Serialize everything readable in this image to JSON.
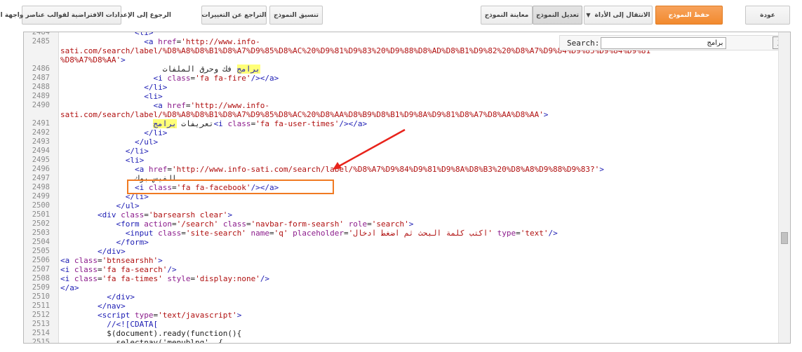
{
  "toolbar": {
    "back": "عودة",
    "save_template": "حفظ النموذج",
    "jump_to_widget": "الانتقال إلى الأداة",
    "edit_template": "تعديل النموذج",
    "preview_template": "معاينة النموذج",
    "format_template": "تنسيق النموذج",
    "revert_changes": "التراجع عن التغييرات",
    "revert_widget_defaults": "الرجوع إلى الإعدادات الافتراضية لقوالب عناصر واجهة المستخدم"
  },
  "search": {
    "label": "Search:",
    "value": "برامج",
    "close": "X"
  },
  "editor": {
    "lines": [
      {
        "n": "2484",
        "segs": [
          [
            "t",
            "                <li>"
          ]
        ]
      },
      {
        "n": "2485",
        "segs": [
          [
            "t",
            "                  <a "
          ],
          [
            "a",
            "href"
          ],
          [
            "x",
            "="
          ],
          [
            "v",
            "'http://www.info-"
          ]
        ]
      },
      {
        "n": "",
        "segs": [
          [
            "v",
            "sati.com/search/label/%D8%A8%D8%B1%D8%A7%D9%85%D8%AC%20%D9%81%D9%83%20%D9%88%D8%AD%D8%B1%D9%82%20%D8%A7%D9%84%D9%85%D9%84%D9%81"
          ]
        ]
      },
      {
        "n": "",
        "segs": [
          [
            "v",
            "%D8%A7%D8%AA'"
          ],
          [
            "t",
            ">"
          ]
        ]
      },
      {
        "n": "2486",
        "segs": [
          [
            "x",
            "                      "
          ],
          [
            "hl",
            "برامج"
          ],
          [
            "x",
            " فك وحرق الملفات"
          ]
        ]
      },
      {
        "n": "2487",
        "segs": [
          [
            "t",
            "                    <i "
          ],
          [
            "a",
            "class"
          ],
          [
            "x",
            "="
          ],
          [
            "v",
            "'fa fa-fire'"
          ],
          [
            "t",
            "/></a>"
          ]
        ]
      },
      {
        "n": "2488",
        "segs": [
          [
            "t",
            "                  </li>"
          ]
        ]
      },
      {
        "n": "2489",
        "segs": [
          [
            "t",
            "                  <li>"
          ]
        ]
      },
      {
        "n": "2490",
        "segs": [
          [
            "t",
            "                    <a "
          ],
          [
            "a",
            "href"
          ],
          [
            "x",
            "="
          ],
          [
            "v",
            "'http://www.info-"
          ]
        ]
      },
      {
        "n": "",
        "segs": [
          [
            "v",
            "sati.com/search/label/%D8%A8%D8%B1%D8%A7%D9%85%D8%AC%20%D8%AA%D8%B9%D8%B1%D9%8A%D9%81%D8%A7%D8%AA%D8%AA'"
          ],
          [
            "t",
            ">"
          ]
        ]
      },
      {
        "n": "2491",
        "segs": [
          [
            "x",
            "                    تعريفات "
          ],
          [
            "hl",
            "برامج"
          ],
          [
            "t",
            "<i "
          ],
          [
            "a",
            "class"
          ],
          [
            "x",
            "="
          ],
          [
            "v",
            "'fa fa-user-times'"
          ],
          [
            "t",
            "/></a>"
          ]
        ]
      },
      {
        "n": "2492",
        "segs": [
          [
            "t",
            "                  </li>"
          ]
        ]
      },
      {
        "n": "2493",
        "segs": [
          [
            "t",
            "                </ul>"
          ]
        ]
      },
      {
        "n": "2494",
        "segs": [
          [
            "t",
            "              </li>"
          ]
        ]
      },
      {
        "n": "2495",
        "segs": [
          [
            "t",
            "              <li>"
          ]
        ]
      },
      {
        "n": "2496",
        "segs": [
          [
            "t",
            "                <a "
          ],
          [
            "a",
            "href"
          ],
          [
            "x",
            "="
          ],
          [
            "v",
            "'http://www.info-sati.com/search/label/%D8%A7%D9%84%D9%81%D9%8A%D8%B3%20%D8%A8%D9%88%D9%83?'"
          ],
          [
            "t",
            ">"
          ]
        ]
      },
      {
        "n": "2497",
        "segs": [
          [
            "x",
            "                الفيس بوك"
          ]
        ]
      },
      {
        "n": "2498",
        "segs": [
          [
            "t",
            "                <i "
          ],
          [
            "a",
            "class"
          ],
          [
            "x",
            "="
          ],
          [
            "v",
            "'fa fa-facebook'"
          ],
          [
            "t",
            "/></a>"
          ]
        ]
      },
      {
        "n": "2499",
        "segs": [
          [
            "t",
            "              </li>"
          ]
        ]
      },
      {
        "n": "2500",
        "segs": [
          [
            "t",
            "            </ul>"
          ]
        ]
      },
      {
        "n": "2501",
        "segs": [
          [
            "t",
            "        <div "
          ],
          [
            "a",
            "class"
          ],
          [
            "x",
            "="
          ],
          [
            "v",
            "'barsearsh clear'"
          ],
          [
            "t",
            ">"
          ]
        ]
      },
      {
        "n": "2502",
        "segs": [
          [
            "t",
            "            <form "
          ],
          [
            "a",
            "action"
          ],
          [
            "x",
            "="
          ],
          [
            "v",
            "'/search'"
          ],
          [
            "x",
            " "
          ],
          [
            "a",
            "class"
          ],
          [
            "x",
            "="
          ],
          [
            "v",
            "'navbar-form-searsh'"
          ],
          [
            "x",
            " "
          ],
          [
            "a",
            "role"
          ],
          [
            "x",
            "="
          ],
          [
            "v",
            "'search'"
          ],
          [
            "t",
            ">"
          ]
        ]
      },
      {
        "n": "2503",
        "segs": [
          [
            "t",
            "              <input "
          ],
          [
            "a",
            "class"
          ],
          [
            "x",
            "="
          ],
          [
            "v",
            "'site-search'"
          ],
          [
            "x",
            " "
          ],
          [
            "a",
            "name"
          ],
          [
            "x",
            "="
          ],
          [
            "v",
            "'q'"
          ],
          [
            "x",
            " "
          ],
          [
            "a",
            "placeholder"
          ],
          [
            "x",
            "="
          ],
          [
            "v",
            "'اكتب كلمة البحث ثم اضغط ادخال'"
          ],
          [
            "x",
            " "
          ],
          [
            "a",
            "type"
          ],
          [
            "x",
            "="
          ],
          [
            "v",
            "'text'"
          ],
          [
            "t",
            "/>"
          ]
        ]
      },
      {
        "n": "2504",
        "segs": [
          [
            "t",
            "            </form>"
          ]
        ]
      },
      {
        "n": "2505",
        "segs": [
          [
            "t",
            "        </div>"
          ]
        ]
      },
      {
        "n": "2506",
        "segs": [
          [
            "t",
            "<a "
          ],
          [
            "a",
            "class"
          ],
          [
            "x",
            "="
          ],
          [
            "v",
            "'btnsearshh'"
          ],
          [
            "t",
            ">"
          ]
        ]
      },
      {
        "n": "2507",
        "segs": [
          [
            "t",
            "<i "
          ],
          [
            "a",
            "class"
          ],
          [
            "x",
            "="
          ],
          [
            "v",
            "'fa fa-search'"
          ],
          [
            "t",
            "/>"
          ]
        ]
      },
      {
        "n": "2508",
        "segs": [
          [
            "t",
            "<i "
          ],
          [
            "a",
            "class"
          ],
          [
            "x",
            "="
          ],
          [
            "v",
            "'fa fa-times'"
          ],
          [
            "x",
            " "
          ],
          [
            "a",
            "style"
          ],
          [
            "x",
            "="
          ],
          [
            "v",
            "'display:none'"
          ],
          [
            "t",
            "/>"
          ]
        ]
      },
      {
        "n": "2509",
        "segs": [
          [
            "t",
            "</a>"
          ]
        ]
      },
      {
        "n": "2510",
        "segs": [
          [
            "t",
            "          </div>"
          ]
        ]
      },
      {
        "n": "2511",
        "segs": [
          [
            "t",
            "        </nav>"
          ]
        ]
      },
      {
        "n": "2512",
        "segs": [
          [
            "t",
            "        <script "
          ],
          [
            "a",
            "type"
          ],
          [
            "x",
            "="
          ],
          [
            "v",
            "'text/javascript'"
          ],
          [
            "t",
            ">"
          ]
        ]
      },
      {
        "n": "2513",
        "segs": [
          [
            "t",
            "          //<![CDATA["
          ]
        ]
      },
      {
        "n": "2514",
        "segs": [
          [
            "x",
            "          $(document).ready(function(){"
          ]
        ]
      },
      {
        "n": "2515",
        "segs": [
          [
            "x",
            "            selectnav('menublng', {"
          ]
        ]
      }
    ]
  }
}
